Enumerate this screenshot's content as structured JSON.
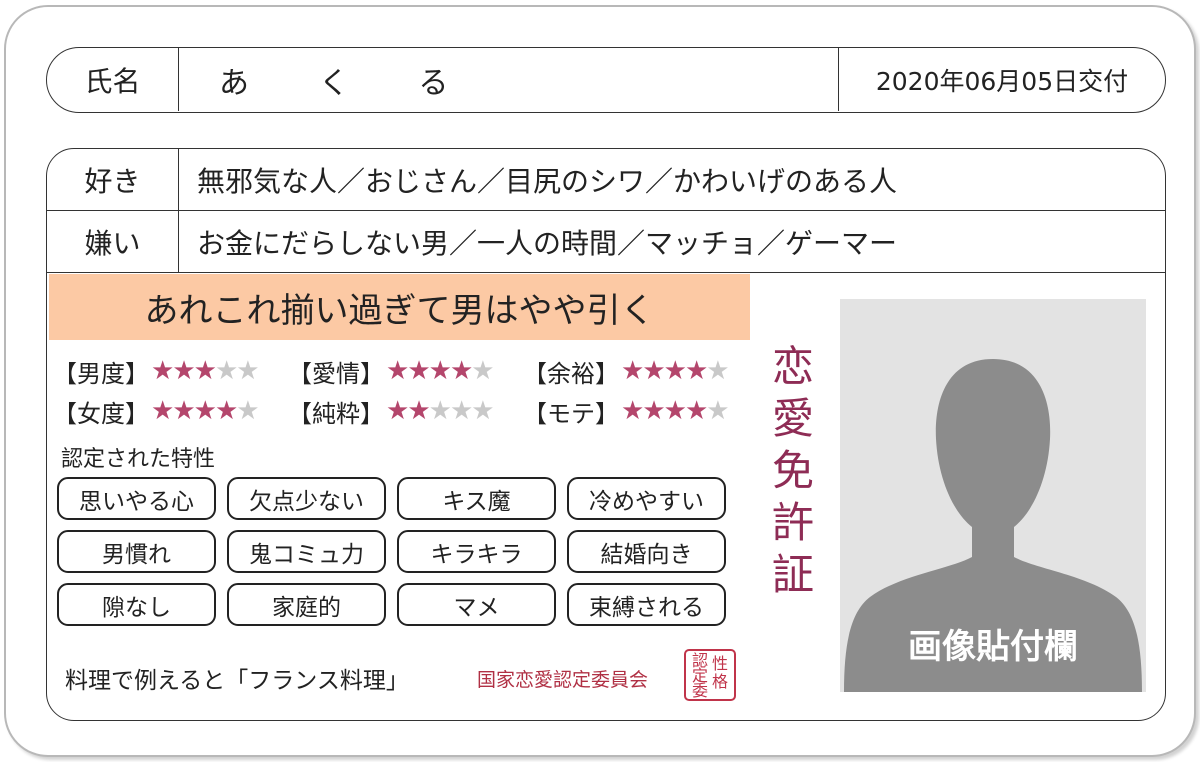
{
  "header": {
    "name_label": "氏名",
    "name": "あくる",
    "issue_date": "2020年06月05日交付"
  },
  "likes": {
    "label": "好き",
    "value": "無邪気な人／おじさん／目尻のシワ／かわいげのある人"
  },
  "dislikes": {
    "label": "嫌い",
    "value": "お金にだらしない男／一人の時間／マッチョ／ゲーマー"
  },
  "headline": "あれこれ揃い過ぎて男はやや引く",
  "ratings": [
    {
      "label": "【男度】",
      "score": 3,
      "max": 5
    },
    {
      "label": "【愛情】",
      "score": 4,
      "max": 5
    },
    {
      "label": "【余裕】",
      "score": 4,
      "max": 5
    },
    {
      "label": "【女度】",
      "score": 4,
      "max": 5
    },
    {
      "label": "【純粋】",
      "score": 2,
      "max": 5
    },
    {
      "label": "【モテ】",
      "score": 4,
      "max": 5
    }
  ],
  "traits_heading": "認定された特性",
  "traits": [
    "思いやる心",
    "欠点少ない",
    "キス魔",
    "冷めやすい",
    "男慣れ",
    "鬼コミュ力",
    "キラキラ",
    "結婚向き",
    "隙なし",
    "家庭的",
    "マメ",
    "束縛される"
  ],
  "food_comparison": "料理で例えると「フランス料理」",
  "committee": "国家恋愛認定委員会",
  "seal": [
    "性",
    "格",
    "認",
    "定",
    "委"
  ],
  "card_title": [
    "恋",
    "愛",
    "免",
    "許",
    "証"
  ],
  "photo_label": "画像貼付欄",
  "colors": {
    "star_on": "#b4466c",
    "star_off": "#c9c9c9",
    "headline_bg": "#fcc9a4",
    "title": "#8e2c55",
    "seal": "#c0344a"
  }
}
